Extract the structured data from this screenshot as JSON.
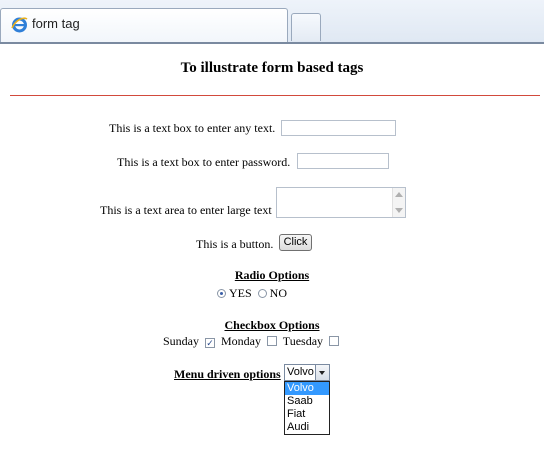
{
  "tab": {
    "title": "form tag",
    "icon": "ie-icon"
  },
  "heading": "To illustrate form based tags",
  "form": {
    "text_label": "This is a text box to enter any text.",
    "password_label": "This is a text box to enter password.",
    "textarea_label": "This is a text area to enter large text",
    "button_label": "This is a button.",
    "button_text": "Click",
    "radio_title": "Radio Options",
    "radio_options": [
      "YES",
      "NO"
    ],
    "radio_selected": "YES",
    "checkbox_title": "Checkbox Options",
    "checkbox_options": [
      {
        "label": "Sunday",
        "checked": true
      },
      {
        "label": "Monday",
        "checked": false
      },
      {
        "label": "Tuesday",
        "checked": false
      }
    ],
    "menu_label": "Menu driven options",
    "menu_selected": "Volvo",
    "menu_options": [
      "Volvo",
      "Saab",
      "Fiat",
      "Audi"
    ]
  },
  "colors": {
    "rule": "#d24a3c",
    "highlight": "#3399ff"
  }
}
